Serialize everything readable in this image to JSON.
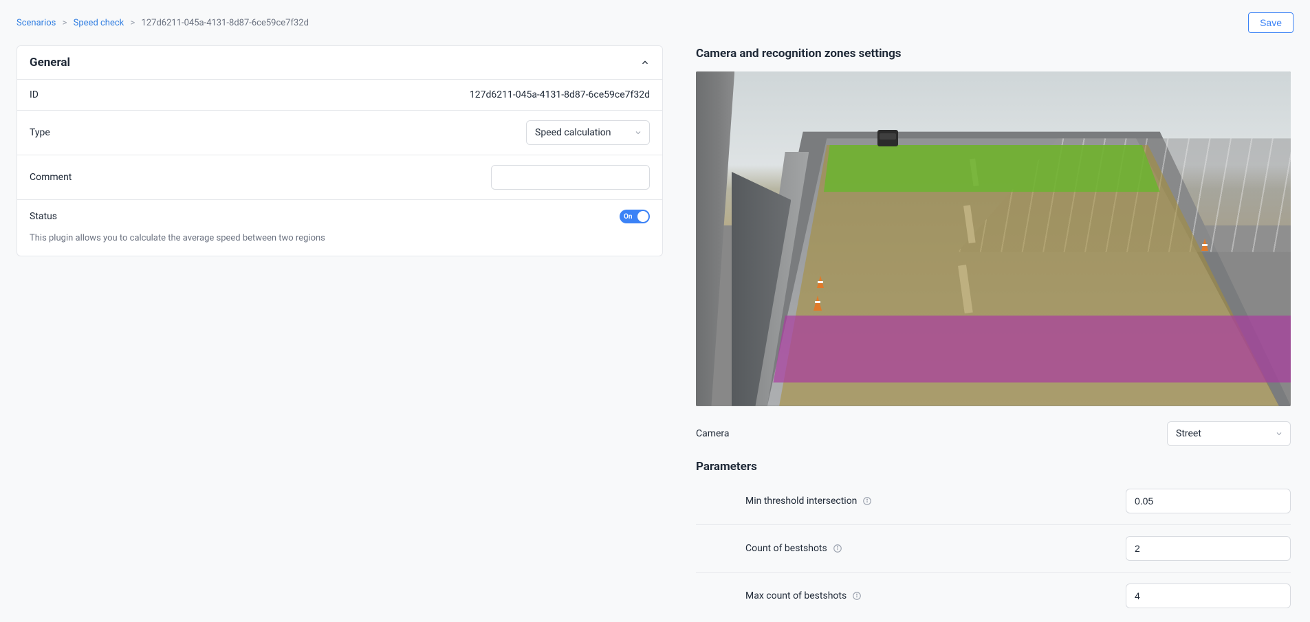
{
  "breadcrumb": {
    "root": "Scenarios",
    "mid": "Speed check",
    "current": "127d6211-045a-4131-8d87-6ce59ce7f32d"
  },
  "actions": {
    "save": "Save"
  },
  "general": {
    "title": "General",
    "id_label": "ID",
    "id_value": "127d6211-045a-4131-8d87-6ce59ce7f32d",
    "type_label": "Type",
    "type_value": "Speed calculation",
    "comment_label": "Comment",
    "comment_value": "",
    "status_label": "Status",
    "status_on_text": "On",
    "description": "This plugin allows you to calculate the average speed between two regions"
  },
  "camera_panel": {
    "title": "Camera and recognition zones settings",
    "camera_label": "Camera",
    "camera_value": "Street",
    "parameters_title": "Parameters",
    "params": {
      "min_threshold_label": "Min threshold intersection",
      "min_threshold_value": "0.05",
      "count_bestshots_label": "Count of bestshots",
      "count_bestshots_value": "2",
      "max_count_bestshots_label": "Max count of bestshots",
      "max_count_bestshots_value": "4"
    }
  }
}
